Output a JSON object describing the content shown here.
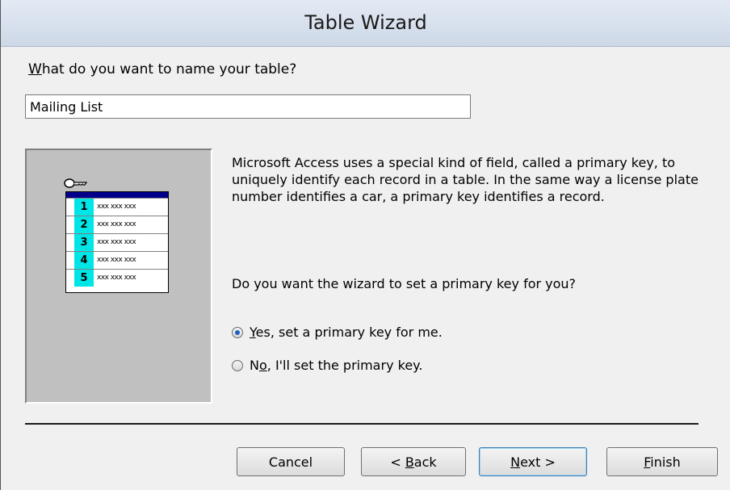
{
  "window": {
    "title": "Table Wizard"
  },
  "name_section": {
    "question_prefix": "W",
    "question_rest": "hat do you want to name your table?",
    "table_name_value": "Mailing List"
  },
  "illustration": {
    "key_icon": "key-icon",
    "rows": [
      "1",
      "2",
      "3",
      "4",
      "5"
    ],
    "filler": "xxx xxx xxx",
    "colors": {
      "header": "#00008b",
      "key_column": "#00e5e5"
    }
  },
  "description": "Microsoft Access uses a special kind of field, called a primary key, to uniquely identify each record in a table. In the same way a license plate number identifies a car, a primary key identifies a record.",
  "primary_key": {
    "prompt": "Do you want the wizard to set a primary key for you?",
    "options": [
      {
        "pre": "",
        "underline": "Y",
        "post": "es, set a primary key for me.",
        "selected": true
      },
      {
        "pre": "N",
        "underline": "o",
        "post": ", I'll set the primary key.",
        "selected": false
      }
    ]
  },
  "buttons": {
    "cancel": "Cancel",
    "back": {
      "pre": "< ",
      "underline": "B",
      "post": "ack"
    },
    "next": {
      "pre": "",
      "underline": "N",
      "post": "ext >"
    },
    "finish": {
      "pre": "",
      "underline": "F",
      "post": "inish"
    }
  }
}
